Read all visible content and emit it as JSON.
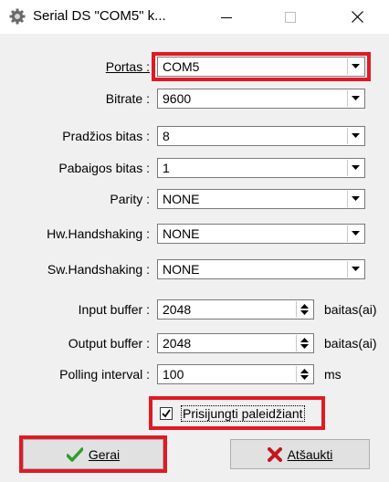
{
  "window": {
    "title": "Serial DS \"COM5\" k...",
    "icon": "gear-icon",
    "controls": [
      "minimize-icon",
      "maximize-icon",
      "close-icon"
    ]
  },
  "fields": {
    "port": {
      "label": "Portas :",
      "value": "COM5"
    },
    "bitrate": {
      "label": "Bitrate :",
      "value": "9600"
    },
    "start_bits": {
      "label": "Pradžios bitas :",
      "value": "8"
    },
    "stop_bits": {
      "label": "Pabaigos bitas :",
      "value": "1"
    },
    "parity": {
      "label": "Parity :",
      "value": "NONE"
    },
    "hw_handshaking": {
      "label": "Hw.Handshaking :",
      "value": "NONE"
    },
    "sw_handshaking": {
      "label": "Sw.Handshaking :",
      "value": "NONE"
    }
  },
  "spins": {
    "input_buffer": {
      "label": "Input buffer :",
      "value": "2048",
      "unit": "baitas(ai)"
    },
    "output_buffer": {
      "label": "Output buffer :",
      "value": "2048",
      "unit": "baitas(ai)"
    },
    "polling_interval": {
      "label": "Polling interval :",
      "value": "100",
      "unit": "ms"
    }
  },
  "checkbox": {
    "label": "Prisijungti paleidžiant",
    "checked": true
  },
  "buttons": {
    "ok": {
      "label": "Gerai",
      "icon": "checkmark-icon"
    },
    "cancel": {
      "label": "Atšaukti",
      "icon": "x-mark-icon"
    }
  },
  "colors": {
    "highlight": "#e01a24",
    "ok_icon": "#2e9e2e",
    "cancel_icon": "#c4161c"
  }
}
